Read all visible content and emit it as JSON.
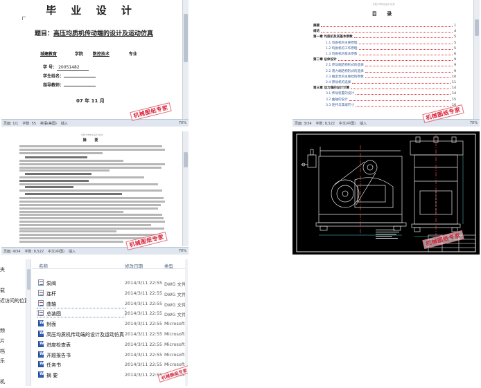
{
  "cover": {
    "title": "毕 业 设 计",
    "topic_label": "题目：",
    "topic": "高压均质机传动端的设计及运动仿真",
    "dept": "城建教育",
    "dept_suffix": "学院",
    "major": "数控技术",
    "major_suffix": "专业",
    "fields": [
      {
        "label": "学    号：",
        "value": "20051482"
      },
      {
        "label": "学生姓名：",
        "value": ""
      },
      {
        "label": "指导教师：",
        "value": ""
      }
    ],
    "date": "07 年 11 月",
    "status": {
      "page": "页面: 1/1",
      "words": "字数: 55",
      "lang": "英语(美国)",
      "mode": "插入",
      "zoom": "70%"
    },
    "watermark": "机械图纸专家"
  },
  "toc": {
    "header": "沈阳大学毕业设计(论文)",
    "title": "目 录",
    "entries": [
      {
        "label": "摘要",
        "page": "1",
        "level": "main"
      },
      {
        "label": "绪论",
        "page": "4",
        "level": "main"
      },
      {
        "label": "第一章 均质机及其基本参数",
        "page": "5",
        "level": "main"
      },
      {
        "label": "1.1 均质机的主要原理",
        "page": "5",
        "level": "sub"
      },
      {
        "label": "1.2 均质机的工作原理",
        "page": "5",
        "level": "sub"
      },
      {
        "label": "1.3 均质机的基本参数",
        "page": "6",
        "level": "sub"
      },
      {
        "label": "第二章 总体设计",
        "page": "9",
        "level": "main"
      },
      {
        "label": "2.1 传动端结构形式的选择",
        "page": "9",
        "level": "sub"
      },
      {
        "label": "2.2 液力端结构形式的选择",
        "page": "9",
        "level": "sub"
      },
      {
        "label": "2.3 确定泵的主要结构参数",
        "page": "10",
        "level": "sub"
      },
      {
        "label": "2.4 原动机的选择",
        "page": "11",
        "level": "sub"
      },
      {
        "label": "第三章 动力端的设计计算",
        "page": "14",
        "level": "main"
      },
      {
        "label": "3.1 传动装置的设计",
        "page": "14",
        "level": "sub"
      },
      {
        "label": "3.2 曲轴的设计",
        "page": "15",
        "level": "sub"
      },
      {
        "label": "3.3 连杆与其端尺寸",
        "page": "16",
        "level": "sub"
      }
    ],
    "status": {
      "page": "页面: 3/34",
      "words": "字数: 8,522",
      "lang": "中文(中国)",
      "mode": "插入",
      "zoom": "70%"
    },
    "watermark": "机械图纸专家"
  },
  "abstract": {
    "header": "沈阳大学毕业设计(论文)",
    "title": "摘 要",
    "status": {
      "page": "页面: 4/34",
      "words": "字数: 8,522",
      "lang": "中文(中国)",
      "mode": "插入",
      "zoom": "70%"
    },
    "watermark": "机械图纸专家"
  },
  "cad": {
    "watermark": "机械图纸专家"
  },
  "explorer": {
    "nav_items": [
      "夹",
      "载",
      "近访问的位置",
      "频",
      "片",
      "档",
      "乐",
      "机"
    ],
    "columns": {
      "name": "名称",
      "date": "修改日期",
      "type": "类型"
    },
    "files": [
      {
        "name": "泵阀",
        "date": "2014/3/11 22:55",
        "type": "DWG 文件",
        "icon": "dwg"
      },
      {
        "name": "连杆",
        "date": "2014/3/11 22:55",
        "type": "DWG 文件",
        "icon": "dwg"
      },
      {
        "name": "曲轴",
        "date": "2014/3/11 22:55",
        "type": "DWG 文件",
        "icon": "dwg"
      },
      {
        "name": "总装图",
        "date": "2014/3/11 22:55",
        "type": "DWG 文件",
        "icon": "dwg",
        "selected": true
      },
      {
        "name": "封面",
        "date": "2014/3/11 22:55",
        "type": "Microsoft W",
        "icon": "word"
      },
      {
        "name": "高压均质机传动端的设计及运动仿真",
        "date": "2014/3/11 22:55",
        "type": "Microsoft W",
        "icon": "word"
      },
      {
        "name": "进度检查表",
        "date": "2014/3/11 22:55",
        "type": "Microsoft W",
        "icon": "word"
      },
      {
        "name": "开题报告书",
        "date": "2014/3/11 22:55",
        "type": "Microsoft W",
        "icon": "word"
      },
      {
        "name": "任务书",
        "date": "2014/3/11 22:55",
        "type": "Microsoft W",
        "icon": "word"
      },
      {
        "name": "摘  要",
        "date": "2014/3/11 22:55",
        "type": "Microsoft W",
        "icon": "word"
      }
    ],
    "watermark": "机械图纸专家"
  }
}
